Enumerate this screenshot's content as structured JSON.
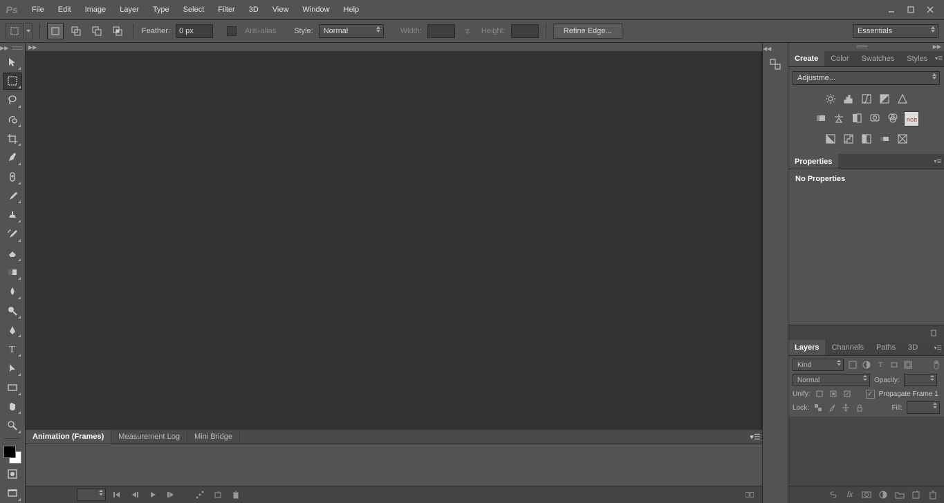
{
  "menubar": {
    "items": [
      "File",
      "Edit",
      "Image",
      "Layer",
      "Type",
      "Select",
      "Filter",
      "3D",
      "View",
      "Window",
      "Help"
    ]
  },
  "optbar": {
    "feather_label": "Feather:",
    "feather_value": "0 px",
    "antialias_label": "Anti-alias",
    "style_label": "Style:",
    "style_value": "Normal",
    "width_label": "Width:",
    "width_value": "",
    "height_label": "Height:",
    "height_value": "",
    "refine_label": "Refine Edge...",
    "workspace": "Essentials"
  },
  "bottom_tabs": {
    "animation": "Animation (Frames)",
    "measurement": "Measurement Log",
    "minibridge": "Mini Bridge"
  },
  "panels": {
    "create_tabs": [
      "Create",
      "Color",
      "Swatches",
      "Styles"
    ],
    "adjust_label": "Adjustme...",
    "properties_tab": "Properties",
    "properties_body": "No Properties",
    "layers_tabs": [
      "Layers",
      "Channels",
      "Paths",
      "3D"
    ],
    "kind_label": "Kind",
    "blend_value": "Normal",
    "opacity_label": "Opacity:",
    "opacity_value": "",
    "unify_label": "Unify:",
    "propagate_label": "Propagate Frame 1",
    "lock_label": "Lock:",
    "fill_label": "Fill:",
    "fill_value": ""
  }
}
